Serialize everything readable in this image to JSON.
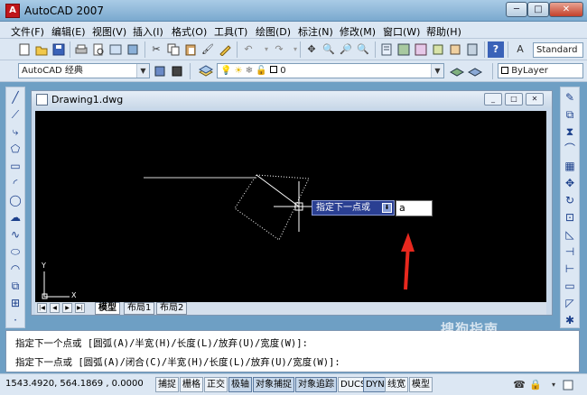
{
  "app": {
    "title": "AutoCAD 2007",
    "icon_label": "A",
    "window_buttons": [
      "─",
      "□",
      "✕"
    ]
  },
  "menu": [
    "文件(F)",
    "编辑(E)",
    "视图(V)",
    "插入(I)",
    "格式(O)",
    "工具(T)",
    "绘图(D)",
    "标注(N)",
    "修改(M)",
    "窗口(W)",
    "帮助(H)"
  ],
  "toolbar": {
    "text_style": "Standard",
    "workspace": "AutoCAD 经典",
    "layer": "0",
    "linetype": "ByLayer"
  },
  "document": {
    "title": "Drawing1.dwg",
    "window_buttons": [
      "_",
      "□",
      "✕"
    ]
  },
  "tabs": [
    "模型",
    "布局1",
    "布局2"
  ],
  "dynamic_input": {
    "prompt": "指定下一点或",
    "prompt_icon": "⬇",
    "value": "a"
  },
  "ucs": {
    "x_label": "X",
    "y_label": "Y"
  },
  "command_lines": [
    "指定下一个点或 [圆弧(A)/半宽(H)/长度(L)/放弃(U)/宽度(W)]:",
    "指定下一点或 [圆弧(A)/闭合(C)/半宽(H)/长度(L)/放弃(U)/宽度(W)]:"
  ],
  "status": {
    "coords": "1543.4920,  564.1869 ,  0.0000",
    "buttons": [
      "捕捉",
      "栅格",
      "正交",
      "极轴",
      "对象捕捉",
      "对象追踪",
      "DUCS",
      "DYN",
      "线宽",
      "模型"
    ]
  },
  "watermark": "搜狗指南",
  "colors": {
    "canvas": "#000000",
    "dyn_prompt_bg": "#2a3f92",
    "arrow": "#e8281e"
  }
}
